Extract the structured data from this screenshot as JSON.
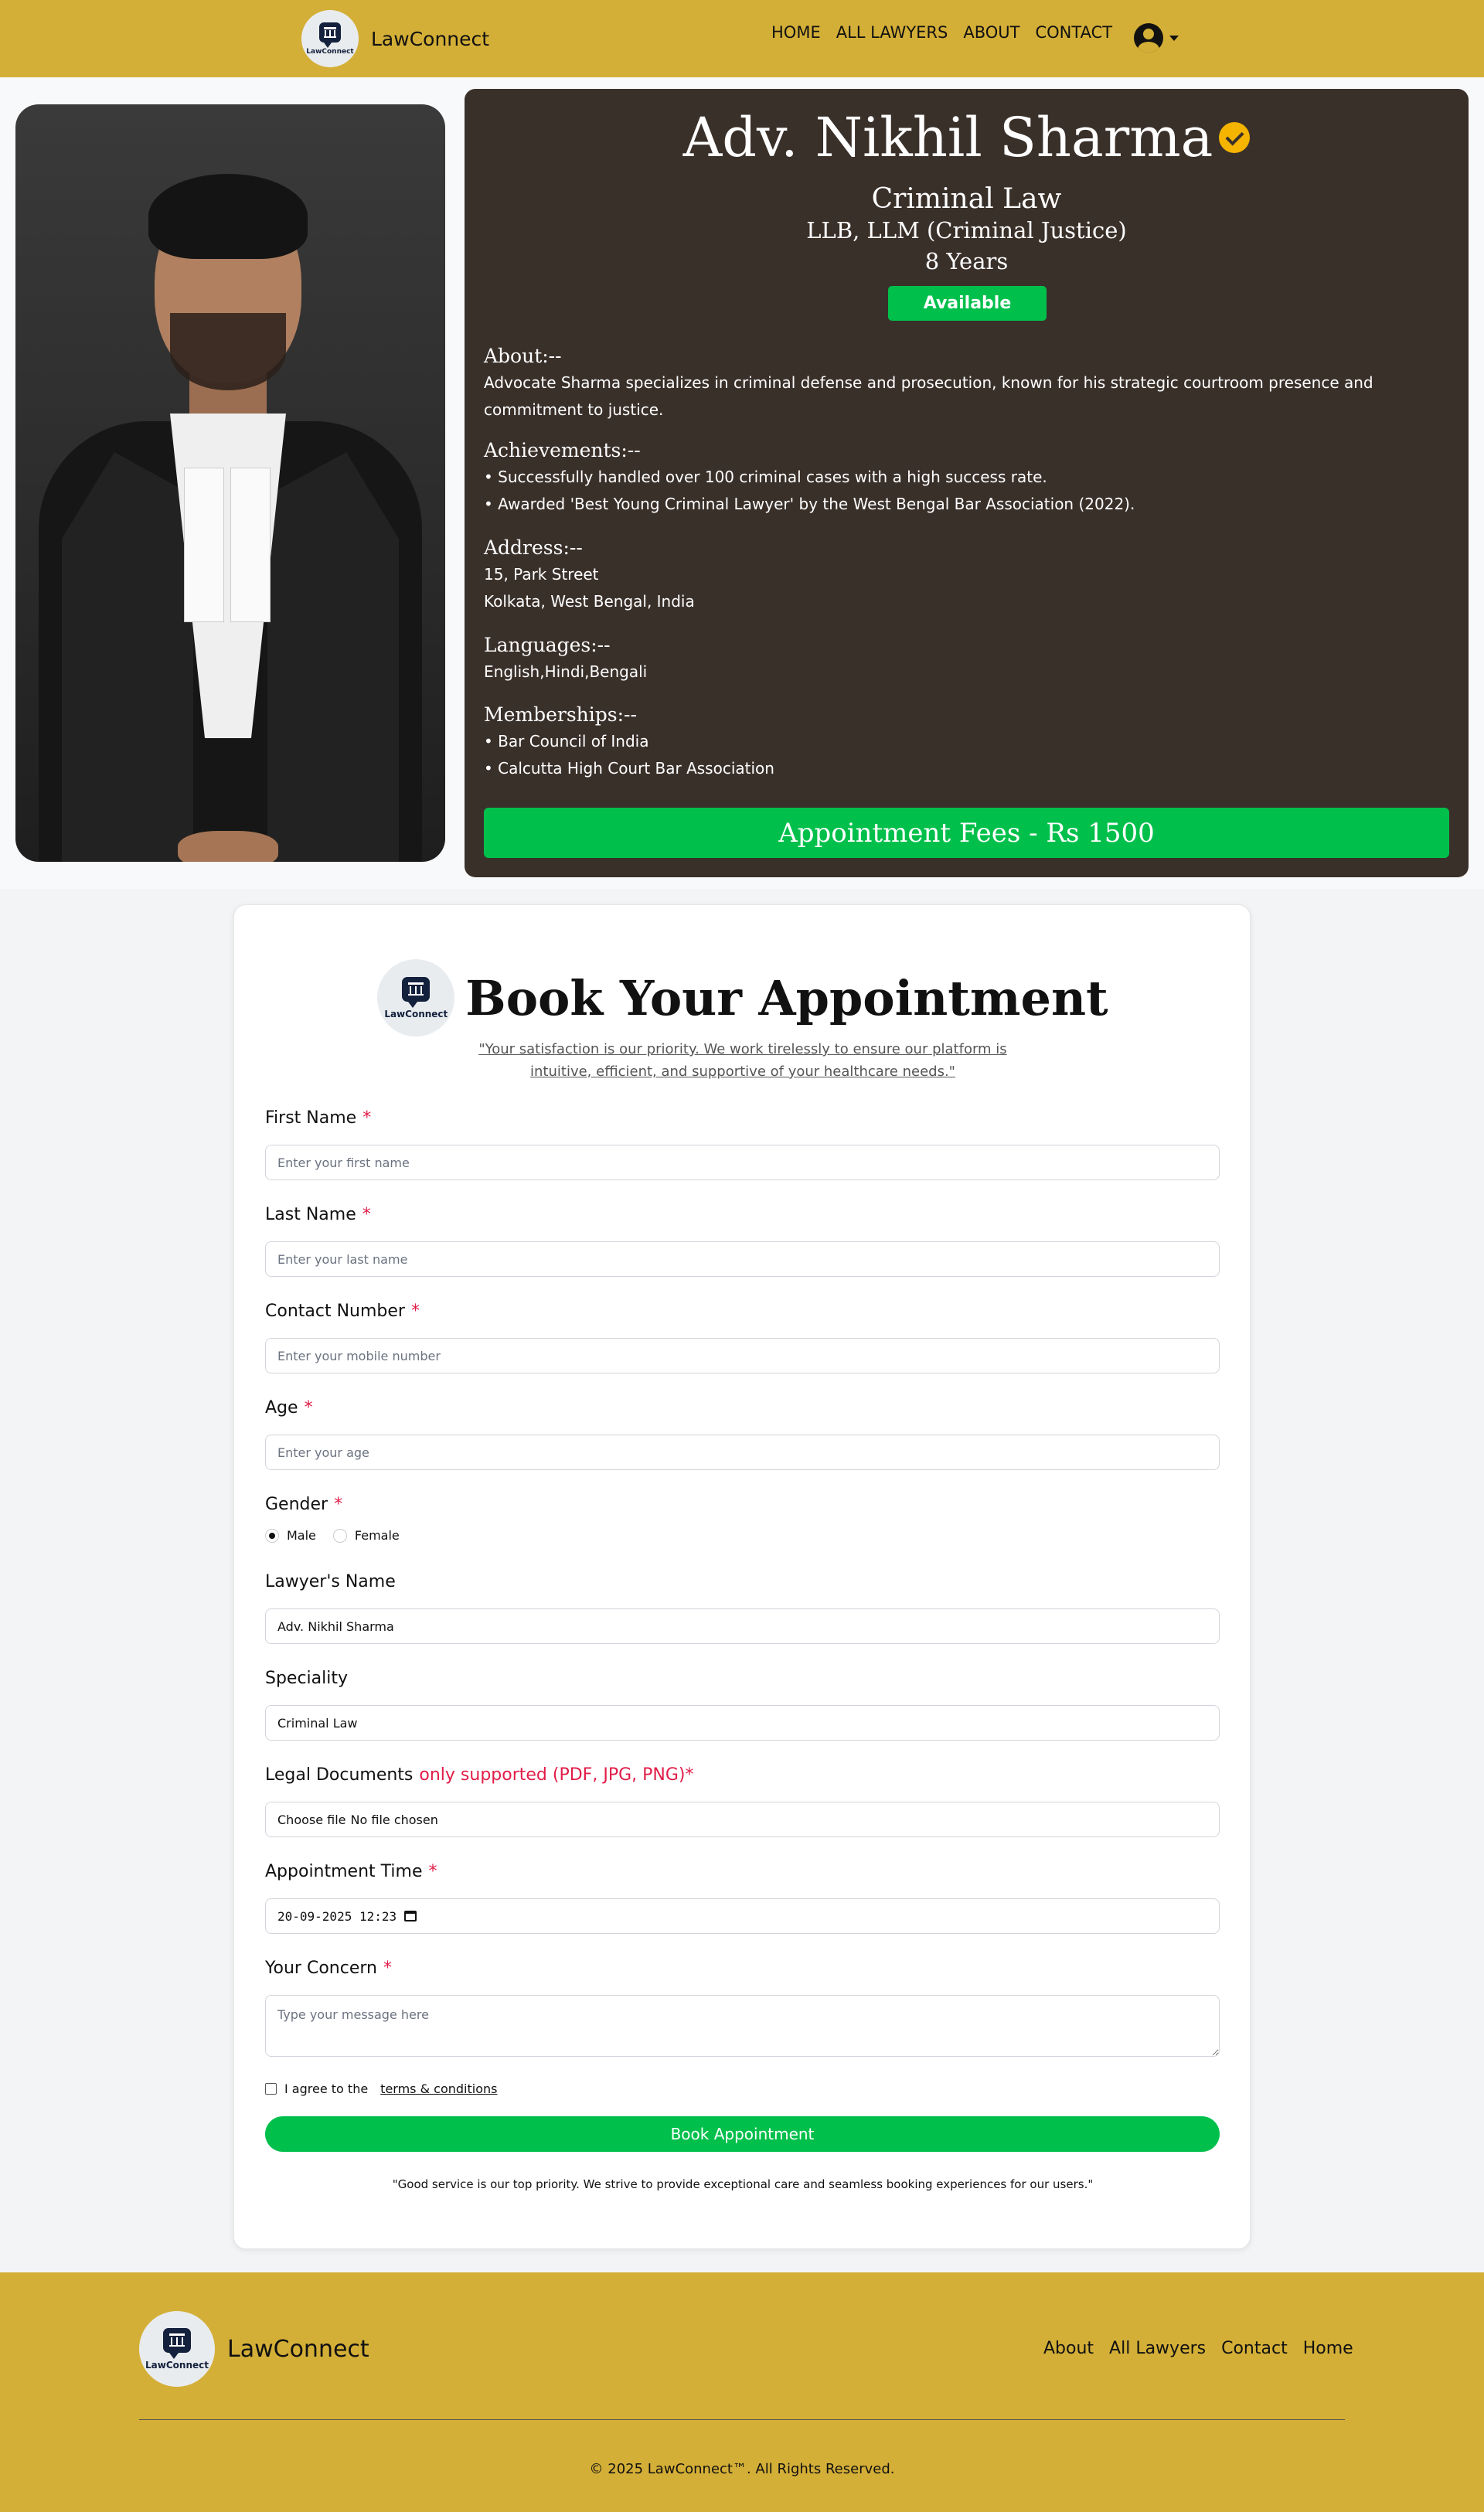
{
  "nav": {
    "brand": "LawConnect",
    "logo_text": "LawConnect",
    "links": [
      "HOME",
      "ALL LAWYERS",
      "ABOUT",
      "CONTACT"
    ]
  },
  "lawyer": {
    "name": "Adv. Nikhil Sharma",
    "speciality": "Criminal Law",
    "degree": "LLB, LLM (Criminal Justice)",
    "experience": "8 Years",
    "status": "Available",
    "about_heading": "About:--",
    "about": "Advocate Sharma specializes in criminal defense and prosecution, known for his strategic courtroom presence and commitment to justice.",
    "achievements_heading": "Achievements:--",
    "achievements": [
      "• Successfully handled over 100 criminal cases with a high success rate.",
      "• Awarded 'Best Young Criminal Lawyer' by the West Bengal Bar Association (2022)."
    ],
    "address_heading": "Address:--",
    "address": [
      "15, Park Street",
      "Kolkata, West Bengal, India"
    ],
    "languages_heading": "Languages:--",
    "languages": "English,Hindi,Bengali",
    "memberships_heading": "Memberships:--",
    "memberships": [
      "• Bar Council of India",
      "• Calcutta High Court Bar Association"
    ],
    "fee_label": "Appointment Fees - Rs 1500"
  },
  "form": {
    "logo_text": "LawConnect",
    "title": "Book Your Appointment",
    "quote": "\"Your satisfaction is our priority. We work tirelessly to ensure our platform is intuitive, efficient, and supportive of your healthcare needs.\"",
    "required_mark": "*",
    "first_name": {
      "label": "First Name",
      "placeholder": "Enter your first name"
    },
    "last_name": {
      "label": "Last Name",
      "placeholder": "Enter your last name"
    },
    "contact": {
      "label": "Contact Number",
      "placeholder": "Enter your mobile number"
    },
    "age": {
      "label": "Age",
      "placeholder": "Enter your age"
    },
    "gender": {
      "label": "Gender",
      "options": [
        "Male",
        "Female"
      ],
      "selected": "Male"
    },
    "lawyer_name": {
      "label": "Lawyer's Name",
      "value": "Adv. Nikhil Sharma"
    },
    "speciality": {
      "label": "Speciality",
      "value": "Criminal Law"
    },
    "documents": {
      "label": "Legal Documents",
      "note": "only supported (PDF, JPG, PNG)*",
      "button": "Choose file",
      "status": "No file chosen"
    },
    "time": {
      "label": "Appointment Time",
      "value": "20-09-2025 12:23"
    },
    "concern": {
      "label": "Your Concern",
      "placeholder": "Type your message here"
    },
    "agree_text": "I agree to the",
    "terms_link": "terms & conditions",
    "submit": "Book Appointment",
    "footer_note": "\"Good service is our top priority. We strive to provide exceptional care and seamless booking experiences for our users.\""
  },
  "footer": {
    "brand": "LawConnect",
    "logo_text": "LawConnect",
    "links": [
      "About",
      "All Lawyers",
      "Contact",
      "Home"
    ],
    "copyright": "© 2025 LawConnect™. All Rights Reserved."
  },
  "colors": {
    "gold": "#d4af37",
    "card_dark": "#3a302a",
    "green": "#00c04b",
    "required_red": "#e11d48"
  }
}
